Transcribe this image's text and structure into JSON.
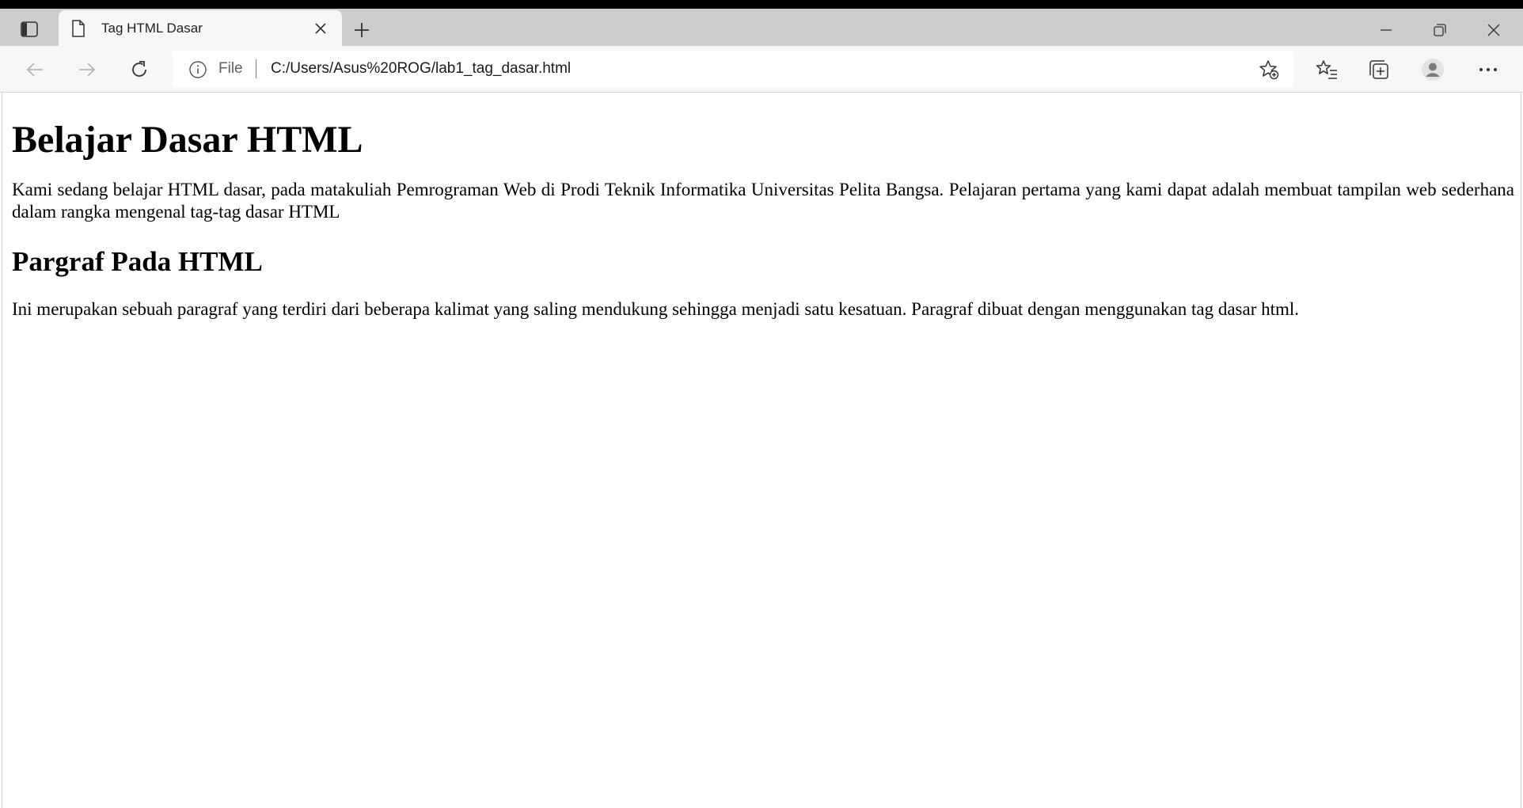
{
  "browser": {
    "tab": {
      "title": "Tag HTML Dasar"
    },
    "address_bar": {
      "scheme_label": "File",
      "url": "C:/Users/Asus%20ROG/lab1_tag_dasar.html"
    },
    "icons": {
      "tab_actions": "tab-actions-icon",
      "page": "document-icon",
      "close_tab": "close-icon",
      "new_tab": "plus-icon",
      "minimize": "minimize-icon",
      "restore": "restore-icon",
      "close_window": "close-icon",
      "back": "arrow-left-icon",
      "forward": "arrow-right-icon",
      "refresh": "refresh-icon",
      "site_info": "info-icon",
      "add_favorite": "star-add-icon",
      "favorites": "favorites-icon",
      "collections": "collections-icon",
      "profile": "profile-icon",
      "more": "more-icon"
    }
  },
  "page": {
    "heading1": "Belajar Dasar HTML",
    "paragraph1": "Kami sedang belajar HTML dasar, pada matakuliah Pemrograman Web di Prodi Teknik Informatika Universitas Pelita Bangsa. Pelajaran pertama yang kami dapat adalah membuat tampilan web sederhana dalam rangka mengenal tag-tag dasar HTML",
    "heading2": "Pargraf Pada HTML",
    "paragraph2": "Ini merupakan sebuah paragraf yang terdiri dari beberapa kalimat yang saling mendukung sehingga menjadi satu kesatuan. Paragraf dibuat dengan menggunakan tag dasar html."
  }
}
